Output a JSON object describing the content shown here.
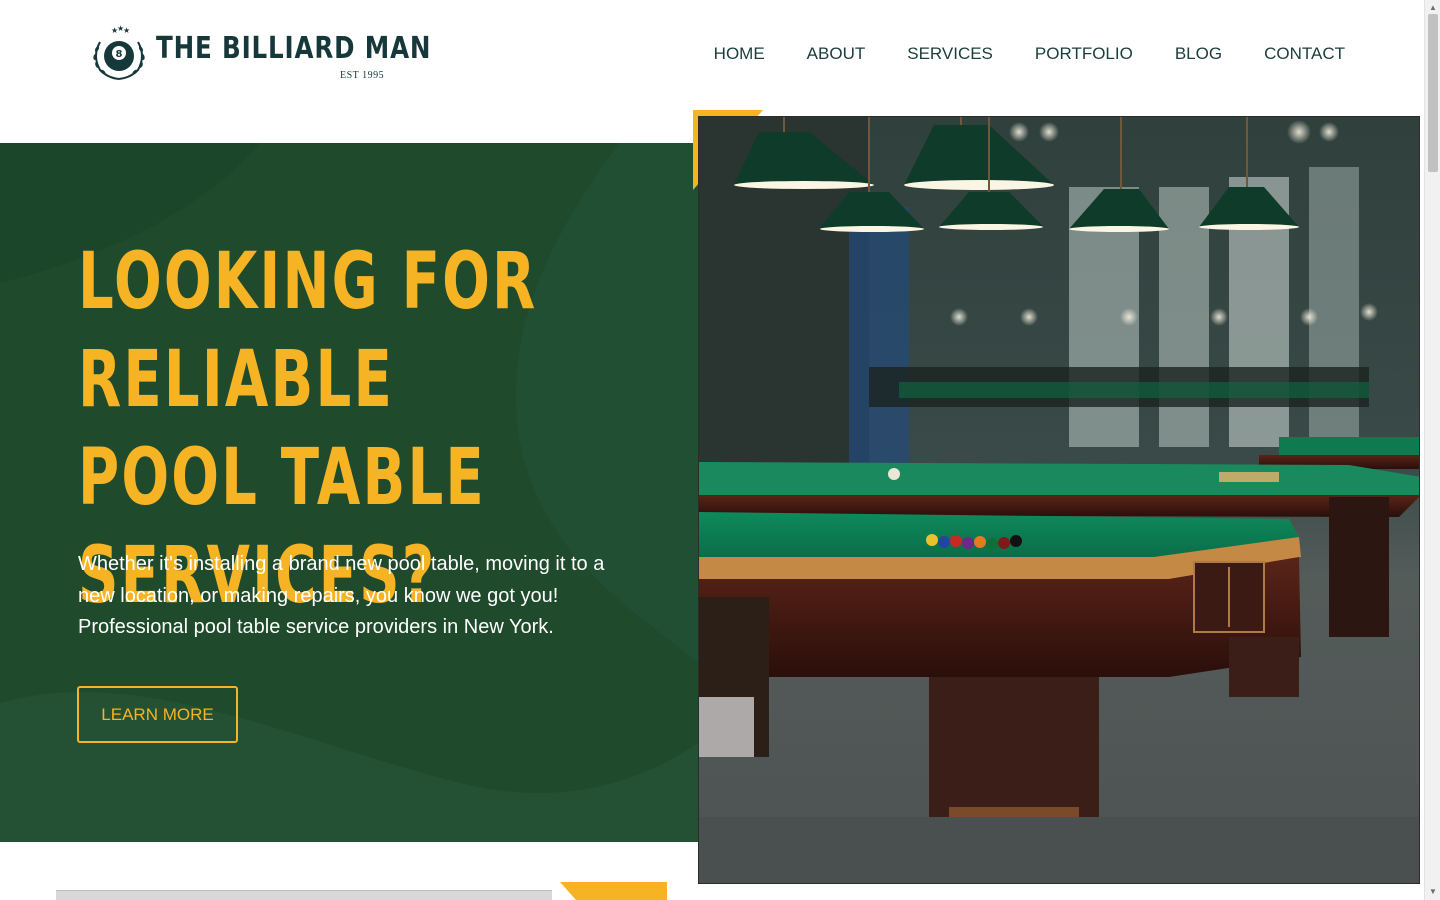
{
  "brand": {
    "name": "THE BILLIARD MAN",
    "est": "EST 1995",
    "ball_number": "8"
  },
  "nav": {
    "items": [
      {
        "label": "HOME"
      },
      {
        "label": "ABOUT"
      },
      {
        "label": "SERVICES"
      },
      {
        "label": "PORTFOLIO"
      },
      {
        "label": "BLOG"
      },
      {
        "label": "CONTACT"
      }
    ]
  },
  "hero": {
    "title_lines": [
      "LOOKING FOR RELIABLE",
      "POOL TABLE",
      "SERVICES?"
    ],
    "body_lines": [
      "Whether it's installing a brand new pool table, moving it to a",
      "new location, or making repairs, you know we got you!",
      "Professional pool table service providers in New York."
    ],
    "cta_label": "LEARN MORE"
  },
  "colors": {
    "accent_yellow": "#f6b323",
    "hero_green": "#1f4a2c",
    "brand_dark": "#17383a",
    "nav_text": "#1b3d3b"
  },
  "icons": {
    "logo": "eight-ball-laurel-icon",
    "scroll_up": "scroll-up-arrow-icon",
    "scroll_down": "scroll-down-arrow-icon"
  }
}
